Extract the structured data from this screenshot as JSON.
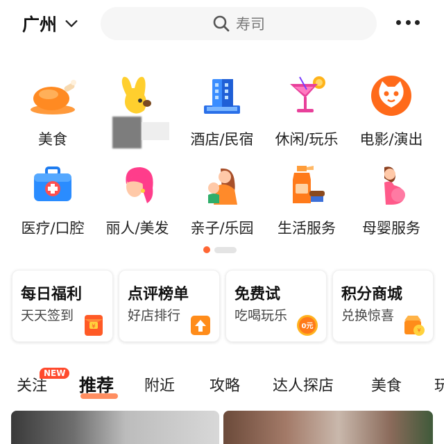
{
  "header": {
    "city": "广州",
    "search_placeholder": "寿司"
  },
  "categories": [
    {
      "label": "美食",
      "icon": "roast-chicken-icon"
    },
    {
      "label": "",
      "icon": "mascot-icon"
    },
    {
      "label": "酒店/民宿",
      "icon": "hotel-building-icon"
    },
    {
      "label": "休闲/玩乐",
      "icon": "cocktail-icon"
    },
    {
      "label": "电影/演出",
      "icon": "cat-face-icon"
    },
    {
      "label": "医疗/口腔",
      "icon": "medical-kit-icon"
    },
    {
      "label": "丽人/美发",
      "icon": "woman-hair-icon"
    },
    {
      "label": "亲子/乐园",
      "icon": "mother-child-icon"
    },
    {
      "label": "生活服务",
      "icon": "cleaning-spray-icon"
    },
    {
      "label": "母婴服务",
      "icon": "pregnant-woman-icon"
    }
  ],
  "promo_cards": [
    {
      "title": "每日福利",
      "subtitle": "天天签到",
      "icon": "red-envelope-icon"
    },
    {
      "title": "点评榜单",
      "subtitle": "好店排行",
      "icon": "ranking-up-icon"
    },
    {
      "title": "免费试",
      "subtitle": "吃喝玩乐",
      "icon": "zero-yuan-coin-icon",
      "icon_text": "0元"
    },
    {
      "title": "积分商城",
      "subtitle": "兑换惊喜",
      "icon": "gift-shop-icon"
    }
  ],
  "tabs": {
    "items": [
      "关注",
      "推荐",
      "附近",
      "攻略",
      "达人探店",
      "美食",
      "玩"
    ],
    "active": "推荐",
    "new_badge": "NEW"
  },
  "colors": {
    "accent": "#ff6633",
    "badge": "#ff4a2d"
  }
}
